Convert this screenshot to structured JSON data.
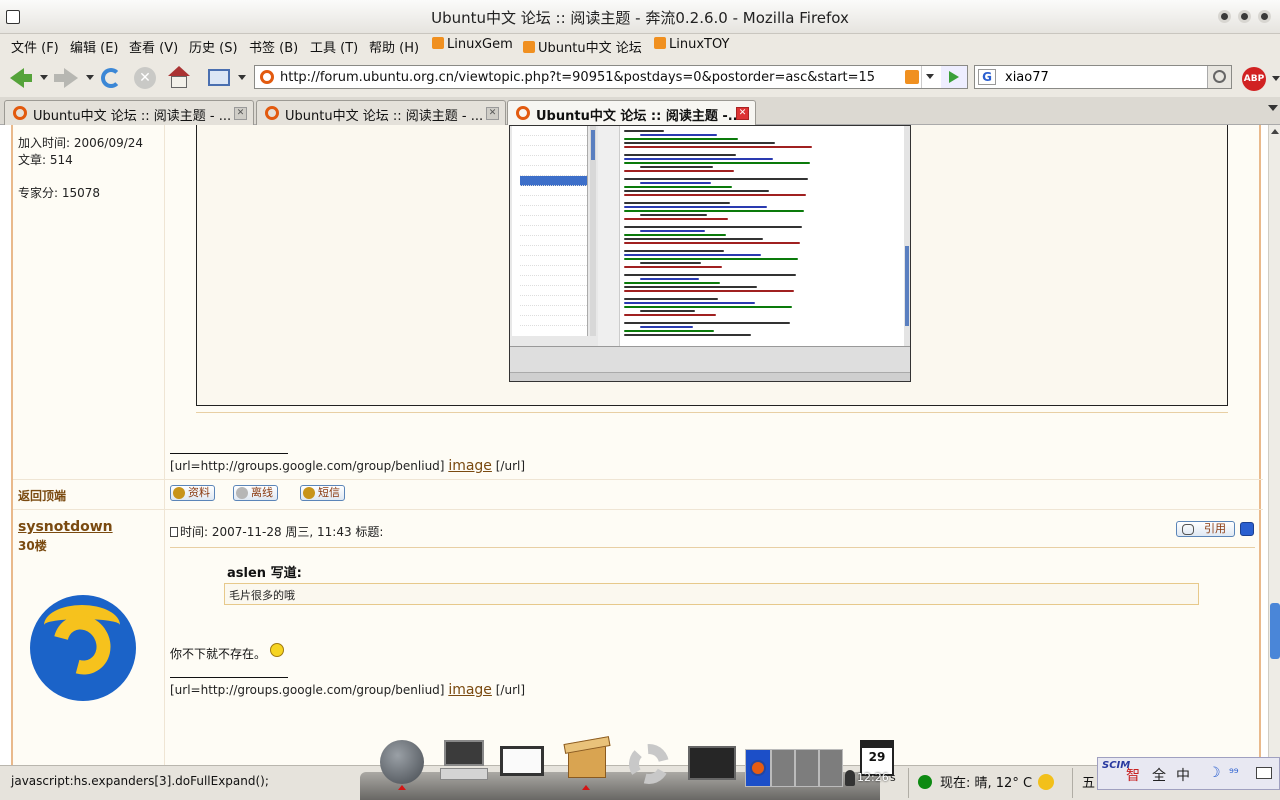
{
  "window": {
    "title": "Ubuntu中文 论坛 :: 阅读主题 - 奔流0.2.6.0 - Mozilla Firefox"
  },
  "menu": {
    "items": [
      "文件 (F)",
      "编辑 (E)",
      "查看 (V)",
      "历史 (S)",
      "书签 (B)",
      "工具 (T)",
      "帮助 (H)"
    ],
    "bookmarks": [
      "LinuxGem",
      "Ubuntu中文 论坛",
      "LinuxTOY"
    ]
  },
  "navbar": {
    "url": "http://forum.ubuntu.org.cn/viewtopic.php?t=90951&postdays=0&postorder=asc&start=15",
    "search_engine": "G",
    "search_value": "xiao77",
    "adblock_label": "ABP"
  },
  "tabs": [
    {
      "label": "Ubuntu中文 论坛 :: 阅读主题 - ...",
      "active": false
    },
    {
      "label": "Ubuntu中文 论坛 :: 阅读主题 - ...",
      "active": false
    },
    {
      "label": "Ubuntu中文 论坛 :: 阅读主题 -...",
      "active": true
    }
  ],
  "previous_post": {
    "joined": "加入时间: 2006/09/24",
    "posts": "文章: 514",
    "expert_score": "专家分: 15078",
    "signature_prefix": "[url=http://groups.google.com/group/benliud]",
    "signature_link": "image",
    "signature_suffix": "[/url]",
    "back_to_top": "返回顶端",
    "buttons": {
      "profile": "资料",
      "offline": "离线",
      "pm": "短信"
    }
  },
  "post": {
    "author": "sysnotdown",
    "floor": "30楼",
    "meta": "时间: 2007-11-28 周三, 11:43    标题:",
    "quote_button": "引用",
    "quote_author": "aslen 写道:",
    "quote_text": "毛片很多的哦",
    "body": "你不下就不存在。",
    "signature_prefix": "[url=http://groups.google.com/group/benliud]",
    "signature_link": "image",
    "signature_suffix": "[/url]"
  },
  "statusbar": {
    "text": "javascript:hs.expanders[3].doFullExpand();",
    "weather": "现在: 晴, 12° C",
    "weekday": "五"
  },
  "panel": {
    "calendar_day": "29",
    "clock": "12:26",
    "clock_suffix": "s"
  },
  "ime": {
    "brand": "SCIM",
    "mode_zhi": "智",
    "mode_full": "全",
    "mode_cn": "中",
    "moon": "☽",
    "nine": "⁹⁹"
  },
  "colors": {
    "forum_border": "#e9b98b",
    "link_brown": "#7a4a10",
    "scrollbar_blue": "#4a86d8"
  }
}
